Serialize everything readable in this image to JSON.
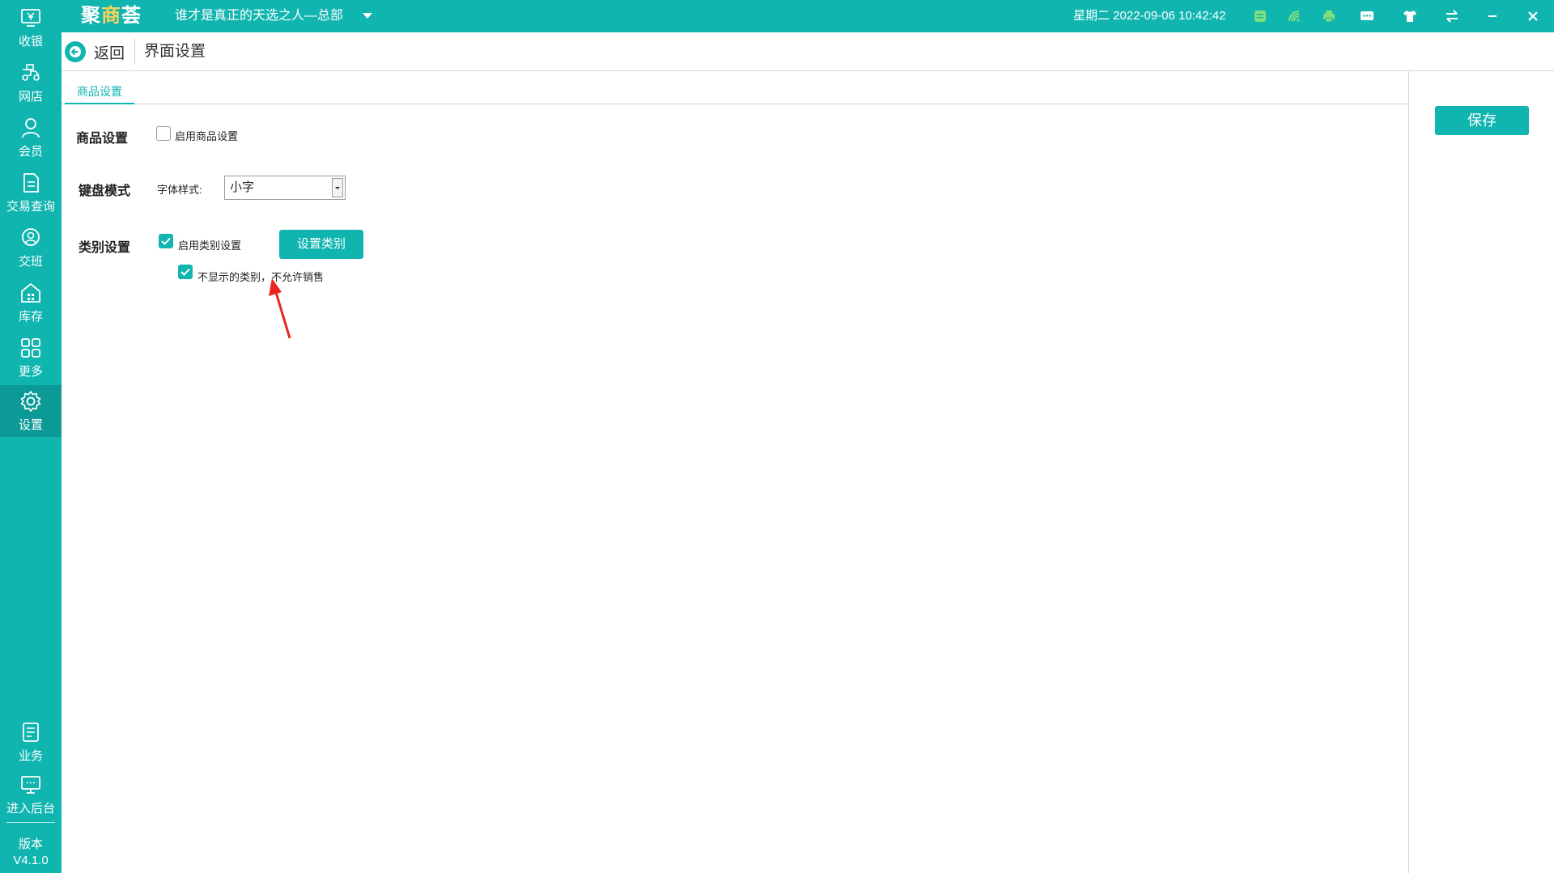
{
  "topbar": {
    "logo_main": "聚",
    "logo_accent": "商",
    "logo_tail": "荟",
    "store_name": "谁才是真正的天选之人—总部",
    "datetime": "星期二 2022-09-06 10:42:42",
    "icons": [
      "database-icon",
      "wifi-signal-icon",
      "printer-icon",
      "message-icon",
      "shirt-theme-icon",
      "switch-arrows-icon",
      "minimize-icon",
      "close-icon"
    ]
  },
  "sidebar": {
    "items": [
      {
        "label": "收银",
        "icon": "cashier-icon"
      },
      {
        "label": "网店",
        "icon": "online-store-icon"
      },
      {
        "label": "会员",
        "icon": "member-icon"
      },
      {
        "label": "交易查询",
        "icon": "transaction-query-icon"
      },
      {
        "label": "交班",
        "icon": "shift-handover-icon"
      },
      {
        "label": "库存",
        "icon": "inventory-icon"
      },
      {
        "label": "更多",
        "icon": "more-grid-icon"
      },
      {
        "label": "设置",
        "icon": "settings-gear-icon",
        "active": true
      }
    ],
    "bottom_items": [
      {
        "label": "业务",
        "icon": "business-icon"
      },
      {
        "label": "进入后台",
        "icon": "backend-monitor-icon"
      }
    ],
    "version_label": "版本",
    "version_value": "V4.1.0"
  },
  "header": {
    "back_label": "返回",
    "title": "界面设置"
  },
  "tabs": [
    {
      "label": "商品设置",
      "active": true
    }
  ],
  "product_settings": {
    "label": "商品设置",
    "enable_label": "启用商品设置",
    "enabled": false
  },
  "keyboard_mode": {
    "label": "键盘模式",
    "font_style_label": "字体样式:",
    "font_style_value": "小字"
  },
  "category_settings": {
    "label": "类别设置",
    "enable_label": "启用类别设置",
    "enabled": true,
    "set_button": "设置类别",
    "hidden_not_for_sale_label": "不显示的类别，不允许销售",
    "hidden_not_for_sale": true
  },
  "actions": {
    "save_label": "保存"
  },
  "colors": {
    "brand": "#10b5b0",
    "brand_dark": "#0c9a96",
    "annotation_arrow": "#e8261c"
  }
}
